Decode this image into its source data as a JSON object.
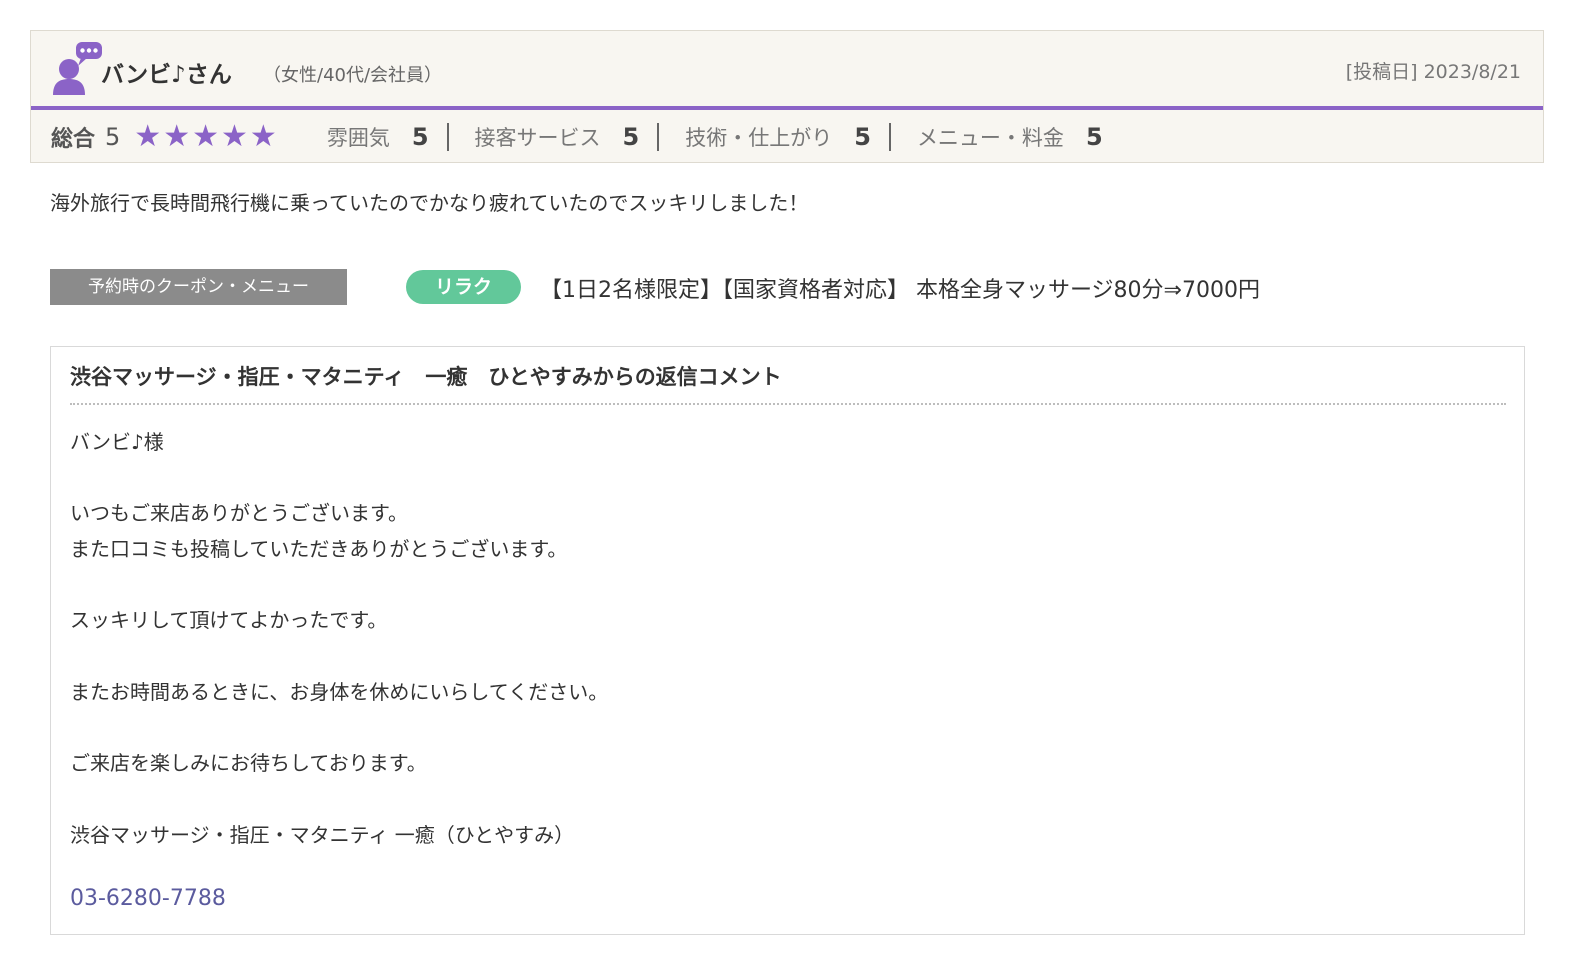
{
  "review": {
    "reviewer_name": "バンビ♪さん",
    "reviewer_meta": "（女性/40代/会社員）",
    "post_date": "[投稿日] 2023/8/21",
    "overall_label": "総合",
    "overall_score": "5",
    "star_count": 5,
    "star_color": "#8b63c7",
    "accent_color": "#8b63c7",
    "ratings": [
      {
        "label": "雰囲気",
        "score": "5"
      },
      {
        "label": "接客サービス",
        "score": "5"
      },
      {
        "label": "技術・仕上がり",
        "score": "5"
      },
      {
        "label": "メニュー・料金",
        "score": "5"
      }
    ],
    "body": "海外旅行で長時間飛行機に乗っていたのでかなり疲れていたのでスッキリしました！"
  },
  "coupon": {
    "label": "予約時のクーポン・メニュー",
    "badge": "リラク",
    "text": "【1日2名様限定】【国家資格者対応】 本格全身マッサージ80分⇒7000円"
  },
  "reply": {
    "title": "渋谷マッサージ・指圧・マタニティ　一癒　ひとやすみからの返信コメント",
    "lines": [
      "バンビ♪様",
      "",
      "いつもご来店ありがとうございます。",
      "また口コミも投稿していただきありがとうございます。",
      "",
      "スッキリして頂けてよかったです。",
      "",
      "またお時間あるときに、お身体を休めにいらしてください。",
      "",
      "ご来店を楽しみにお待ちしております。",
      "",
      "渋谷マッサージ・指圧・マタニティ 一癒（ひとやすみ）"
    ],
    "phone": "03-6280-7788"
  }
}
